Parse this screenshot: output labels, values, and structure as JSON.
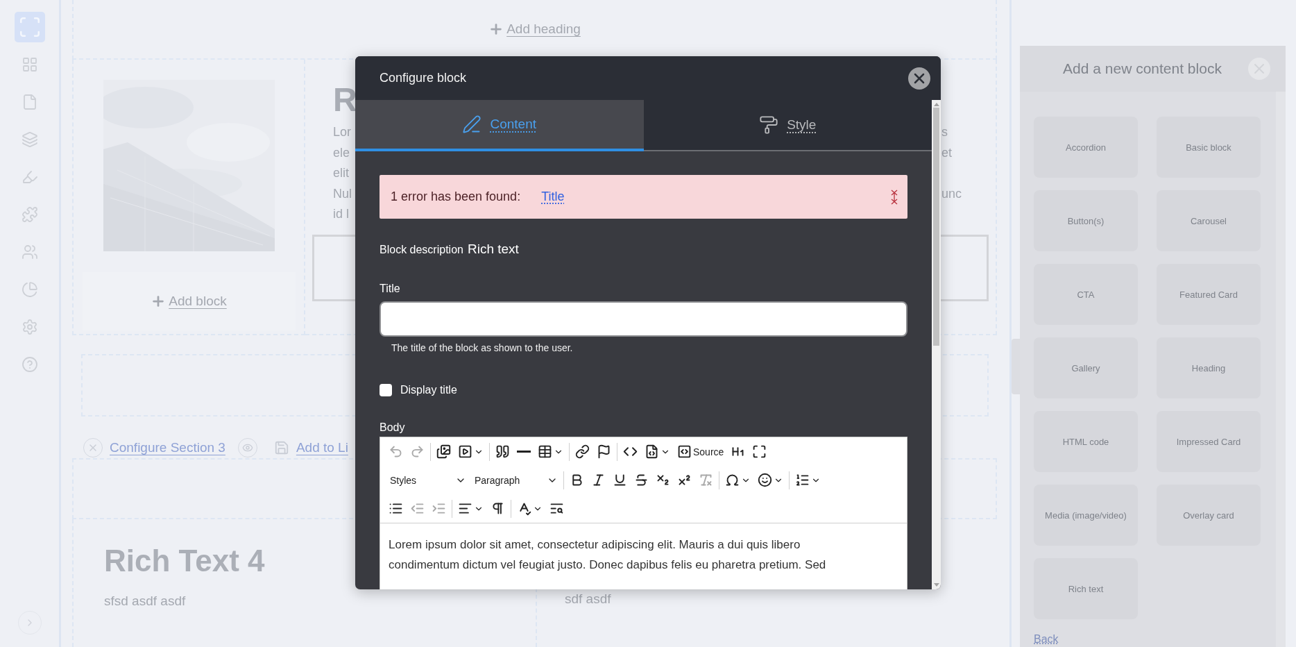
{
  "sidebar": {
    "items": [
      {
        "selected": true
      },
      {
        "selected": false
      },
      {
        "selected": false
      },
      {
        "selected": false
      },
      {
        "selected": false
      },
      {
        "selected": false
      },
      {
        "selected": false
      },
      {
        "selected": false
      },
      {
        "selected": false
      },
      {
        "selected": false
      }
    ]
  },
  "page": {
    "add_heading": "Add heading",
    "add_block": "Add block",
    "text_column": {
      "heading": "R",
      "lines": [
        {
          "left": "Lor",
          "right": "s"
        },
        {
          "left": "ele",
          "right": "et"
        },
        {
          "left": "elit"
        },
        {
          "left": "Nul",
          "right": "unc"
        },
        {
          "left": "id l"
        }
      ]
    },
    "section_toolbar": {
      "configure": "Configure Section 3",
      "add_to_library": "Add to Li"
    },
    "rich_text_4": {
      "title": "Rich Text 4",
      "text": "sfsd asdf asdf",
      "right_text": "sdf asdf"
    }
  },
  "content_block_panel": {
    "title": "Add a new content block",
    "blocks": [
      "Accordion",
      "Basic block",
      "Button(s)",
      "Carousel",
      "CTA",
      "Featured Card",
      "Gallery",
      "Heading",
      "HTML code",
      "Impressed Card",
      "Media (image/video)",
      "Overlay card",
      "Rich text"
    ],
    "back": "Back"
  },
  "modal": {
    "title": "Configure block",
    "tabs": [
      {
        "label": "Content",
        "selected": true
      },
      {
        "label": "Style",
        "selected": false
      }
    ],
    "alert": {
      "message": "1 error has been found:",
      "link": "Title"
    },
    "block_description": {
      "label": "Block description",
      "value": "Rich text"
    },
    "title_field": {
      "label": "Title",
      "help": "The title of the block as shown to the user."
    },
    "display_title": {
      "label": "Display title",
      "checked": false
    },
    "body": {
      "label": "Body",
      "toolbar": [
        [
          [
            {
              "kind": "icon",
              "disabled": true
            },
            {
              "kind": "icon",
              "disabled": true
            }
          ],
          [
            {
              "kind": "icon",
              "disabled": false
            },
            {
              "kind": "icon",
              "disabled": false,
              "dropdown": true
            }
          ],
          [
            {
              "kind": "icon",
              "disabled": false
            },
            {
              "kind": "icon",
              "disabled": false
            },
            {
              "kind": "icon",
              "disabled": false,
              "dropdown": true
            }
          ],
          [
            {
              "kind": "icon",
              "disabled": false
            },
            {
              "kind": "icon",
              "disabled": false
            }
          ],
          [
            {
              "kind": "icon",
              "disabled": false
            },
            {
              "kind": "icon",
              "disabled": false,
              "dropdown": true
            },
            {
              "kind": "labeled",
              "label": "Source",
              "disabled": false
            },
            {
              "kind": "icon",
              "disabled": false
            },
            {
              "kind": "icon",
              "disabled": false
            }
          ]
        ],
        [
          [
            {
              "kind": "select",
              "label": "Styles"
            },
            {
              "kind": "select",
              "label": "Paragraph"
            }
          ],
          [
            {
              "kind": "icon",
              "disabled": false
            },
            {
              "kind": "icon",
              "disabled": false
            },
            {
              "kind": "icon",
              "disabled": false
            },
            {
              "kind": "icon",
              "disabled": false
            },
            {
              "kind": "icon",
              "disabled": false
            },
            {
              "kind": "icon",
              "disabled": false
            },
            {
              "kind": "icon",
              "disabled": true
            }
          ],
          [
            {
              "kind": "icon",
              "disabled": false,
              "dropdown": true
            },
            {
              "kind": "icon",
              "disabled": false,
              "dropdown": true
            }
          ],
          [
            {
              "kind": "icon",
              "disabled": false,
              "dropdown": true
            }
          ]
        ],
        [
          [
            {
              "kind": "icon",
              "disabled": false
            },
            {
              "kind": "icon",
              "disabled": true
            },
            {
              "kind": "icon",
              "disabled": true
            }
          ],
          [
            {
              "kind": "icon",
              "disabled": false,
              "dropdown": true
            },
            {
              "kind": "icon",
              "disabled": false
            }
          ],
          [
            {
              "kind": "icon",
              "disabled": false,
              "dropdown": true
            },
            {
              "kind": "icon",
              "disabled": false
            }
          ]
        ]
      ],
      "content_lines": [
        "Lorem ipsum dolor sit amet, consectetur adipiscing elit. Mauris a dui quis libero",
        "condimentum dictum vel feugiat justo. Donec dapibus felis eu pharetra pretium. Sed"
      ]
    }
  }
}
